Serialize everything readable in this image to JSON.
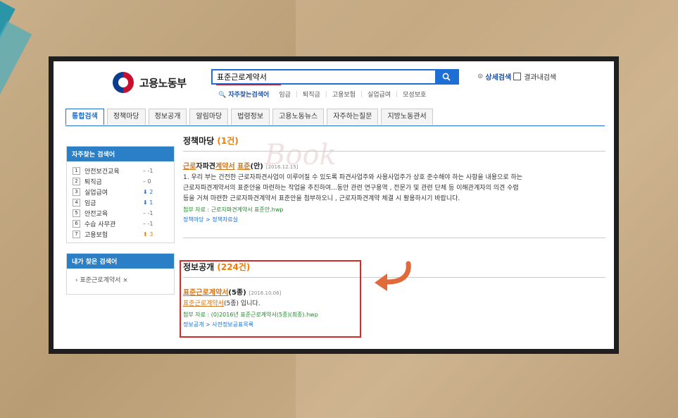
{
  "logo": {
    "text": "고용노동부"
  },
  "search": {
    "value": "표준근로계약서"
  },
  "frequent": {
    "label": "자주찾는검색어",
    "items": [
      "임금",
      "퇴직금",
      "고용보험",
      "실업급여",
      "모성보호"
    ]
  },
  "advanced": {
    "label": "상세검색",
    "in_result": "결과내검색"
  },
  "tabs": [
    "통합검색",
    "정책마당",
    "정보공개",
    "알림마당",
    "법령정보",
    "고용노동뉴스",
    "자주하는질문",
    "지방노동관서"
  ],
  "popular": {
    "title": "자주찾는 검색어",
    "items": [
      {
        "rank": "1",
        "label": "안전보건교육",
        "change": "– -1",
        "dir": "same"
      },
      {
        "rank": "2",
        "label": "퇴직금",
        "change": "– 0",
        "dir": "same"
      },
      {
        "rank": "3",
        "label": "실업급여",
        "change": "⬇ 2",
        "dir": "down"
      },
      {
        "rank": "4",
        "label": "임금",
        "change": "⬇ 1",
        "dir": "down"
      },
      {
        "rank": "5",
        "label": "안전교육",
        "change": "– -1",
        "dir": "same"
      },
      {
        "rank": "6",
        "label": "수습 사무관",
        "change": "– -1",
        "dir": "same"
      },
      {
        "rank": "7",
        "label": "고용보험",
        "change": "⬆ 3",
        "dir": "up"
      }
    ]
  },
  "my_searches": {
    "title": "내가 찾은 검색어",
    "items": [
      "표준근로계약서 ×"
    ]
  },
  "section1": {
    "title": "정책마당",
    "count": "(1건)",
    "result": {
      "title_k1": "근로",
      "title_mid": "자파견",
      "title_k2": "계약서",
      "title_sp": " ",
      "title_k3": "표준",
      "title_end": "(안)",
      "date": "[2016.12.15]",
      "line1": "1. 우리 부는 건전한 근로자파견사업이 이루어질 수 있도록 파견사업주와 사용사업주가 상호 준수해야 하는 사항을 내용으로 하는",
      "line2": "근로자파견계약서의 표준안을 마련하는 작업을 추진하여...동안 관련 연구용역 , 전문가 및 관련 단체 등 이해관계자의 의견 수렴",
      "line3": "등을 거쳐 마련한 근로자파견계약서 표준안을 첨부하오니 , 근로자파견계약 체결 시 활용하시기 바랍니다.",
      "attach": "첨부 자료 : 근로자파견계약서 표준안.hwp",
      "path": "정책마당 > 정책자료실"
    }
  },
  "section2": {
    "title": "정보공개",
    "count": "(224건)",
    "result": {
      "title_k": "표준근로계약서",
      "title_end": "(5종)",
      "date": "[2016.10.06]",
      "body_k": "표준근로계약서",
      "body_end": "(5종) 입니다.",
      "attach": "첨부 자료 : (0)2016년 표준근로계약서(5종)(최종).hwp",
      "path": "정보공개 > 사전정보공표목록"
    }
  },
  "watermark": "Book"
}
